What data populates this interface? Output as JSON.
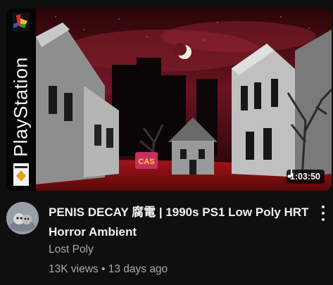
{
  "thumbnail": {
    "spine_label": "PlayStation",
    "sign_text": "CAS",
    "duration": "1:03:50",
    "duration_icon": "music-note-icon"
  },
  "video": {
    "title": "PENIS DECAY 腐電 | 1990s PS1 Low Poly HRT Horror Ambient",
    "channel": "Lost Poly",
    "views": "13K views",
    "separator": "•",
    "age": "13 days ago"
  },
  "menu": {
    "icon": "more-vert-icon"
  },
  "colors": {
    "background": "#0f0f0f",
    "title": "#f1f1f1",
    "secondary_text": "#aaaaaa",
    "sky": "#5a0f1a",
    "ground": "#8a0c0c"
  }
}
